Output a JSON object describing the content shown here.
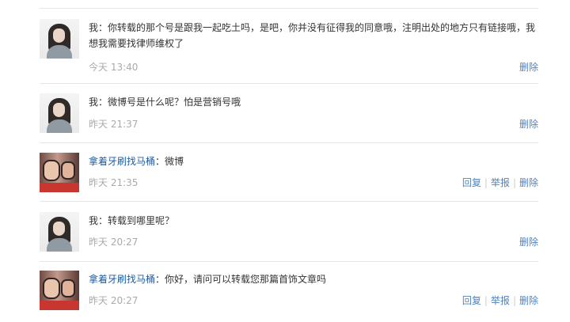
{
  "comments": [
    {
      "author": "我",
      "author_is_link": false,
      "text": "你转载的那个号是跟我一起吃土吗，是吧，你并没有征得我的同意哦，注明出处的地方只有链接哦，我想我需要找律师维权了",
      "time": "今天 13:40",
      "actions": [
        "删除"
      ]
    },
    {
      "author": "我",
      "author_is_link": false,
      "text": "微博号是什么呢？怕是营销号哦",
      "time": "昨天 21:37",
      "actions": [
        "删除"
      ]
    },
    {
      "author": "拿着牙刷找马桶",
      "author_is_link": true,
      "text": "微博",
      "time": "昨天 21:35",
      "actions": [
        "回复",
        "举报",
        "删除"
      ]
    },
    {
      "author": "我",
      "author_is_link": false,
      "text": "转载到哪里呢？",
      "time": "昨天 20:27",
      "actions": [
        "删除"
      ]
    },
    {
      "author": "拿着牙刷找马桶",
      "author_is_link": true,
      "text": "你好，请问可以转载您那篇首饰文章吗",
      "time": "昨天 20:27",
      "actions": [
        "回复",
        "举报",
        "删除"
      ]
    }
  ],
  "separator": "：",
  "colors": {
    "link": "#1f5c9e",
    "action": "#4e82be",
    "meta": "#aaaaaa",
    "rule": "#e6e6e6"
  },
  "icons": {
    "self_avatar": "user-photo-avatar",
    "other_avatar": "baby-photo-avatar"
  }
}
